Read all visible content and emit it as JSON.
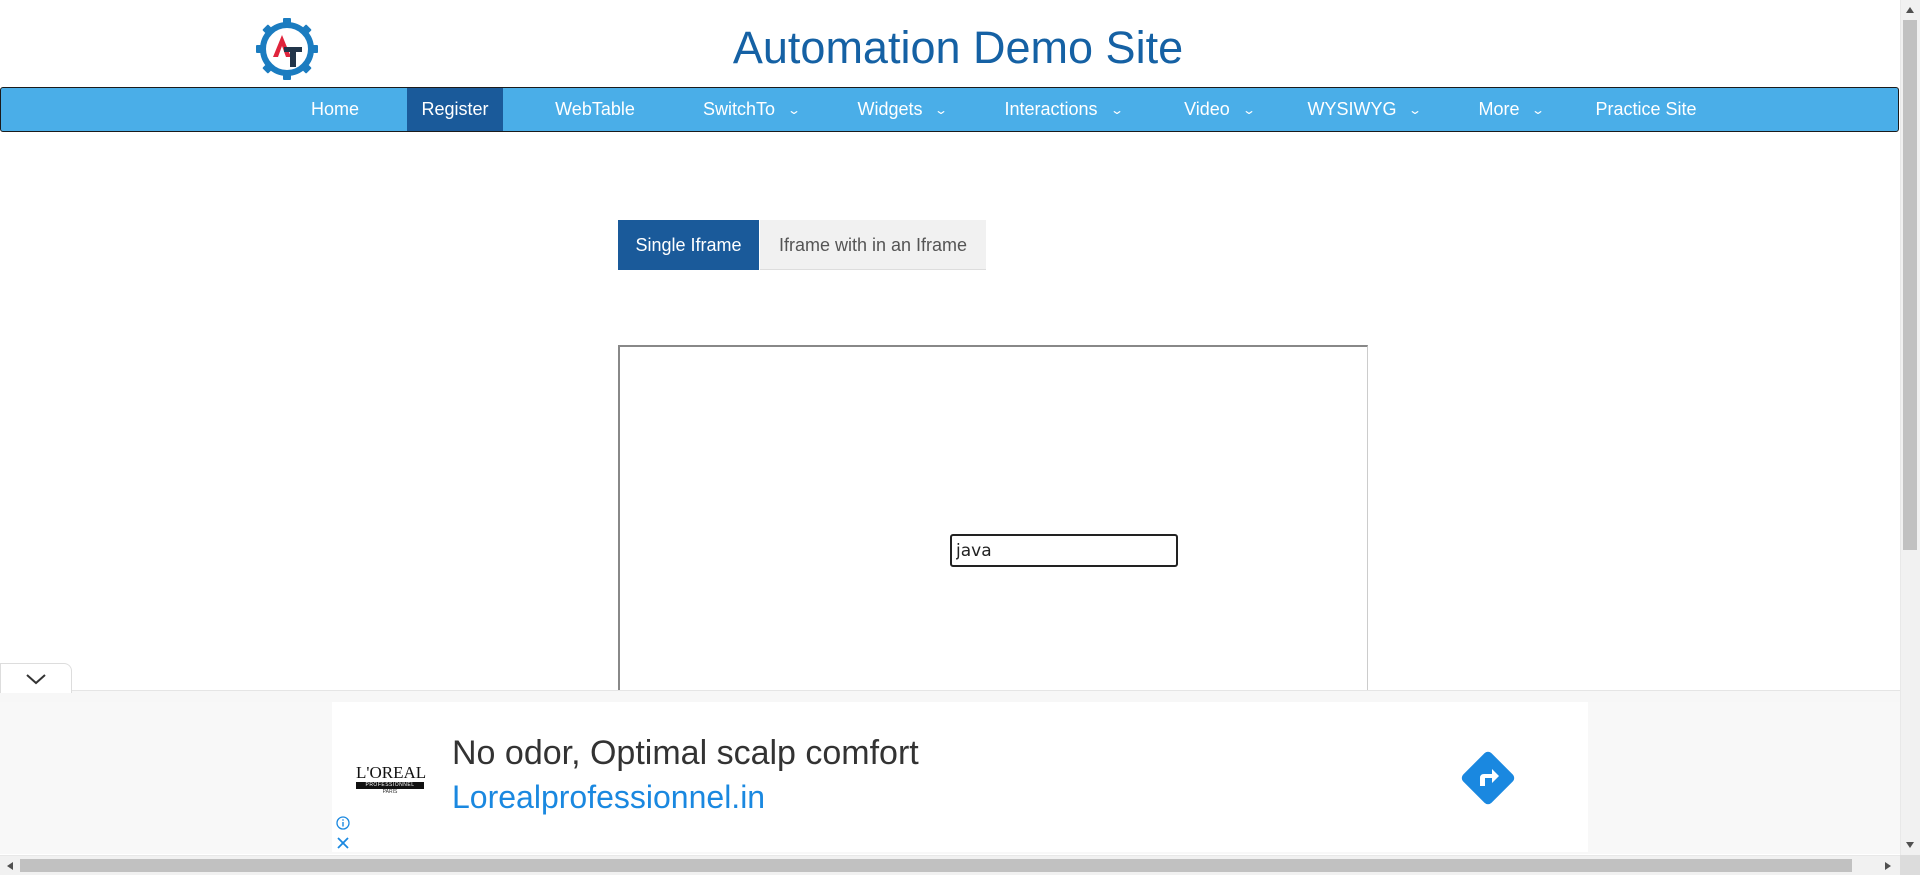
{
  "header": {
    "title": "Automation Demo Site",
    "logo_icon": "gear-logo-icon",
    "logo_letters": "AT",
    "colors": {
      "title": "#1561a4",
      "logo_gear": "#1b7cc0",
      "logo_a": "#e0243c",
      "logo_t": "#22354a"
    }
  },
  "nav": {
    "items": [
      {
        "label": "Home"
      },
      {
        "label": "Register",
        "active": true
      },
      {
        "label": "WebTable"
      },
      {
        "label": "SwitchTo",
        "dropdown": true
      },
      {
        "label": "Widgets",
        "dropdown": true
      },
      {
        "label": "Interactions",
        "dropdown": true
      },
      {
        "label": "Video",
        "dropdown": true
      },
      {
        "label": "WYSIWYG",
        "dropdown": true
      },
      {
        "label": "More",
        "dropdown": true
      },
      {
        "label": "Practice Site"
      }
    ],
    "colors": {
      "bar": "#4aaee8",
      "active": "#1a5a9a"
    }
  },
  "tabs": [
    {
      "label": "Single Iframe",
      "active": true
    },
    {
      "label": "Iframe with in an Iframe"
    }
  ],
  "iframe": {
    "input_value": "java"
  },
  "ad": {
    "collapse_icon": "chevron-down-icon",
    "brand": "L'OREAL",
    "brand_sub": "PROFESSIONNEL",
    "brand_city": "PARIS",
    "headline": "No odor, Optimal scalp comfort",
    "link": "Lorealprofessionnel.in",
    "cta_icon": "directions-arrow-icon",
    "info_icon": "info-icon",
    "close_icon": "close-icon",
    "colors": {
      "link": "#1a88e0",
      "cta": "#1a88e0"
    }
  }
}
